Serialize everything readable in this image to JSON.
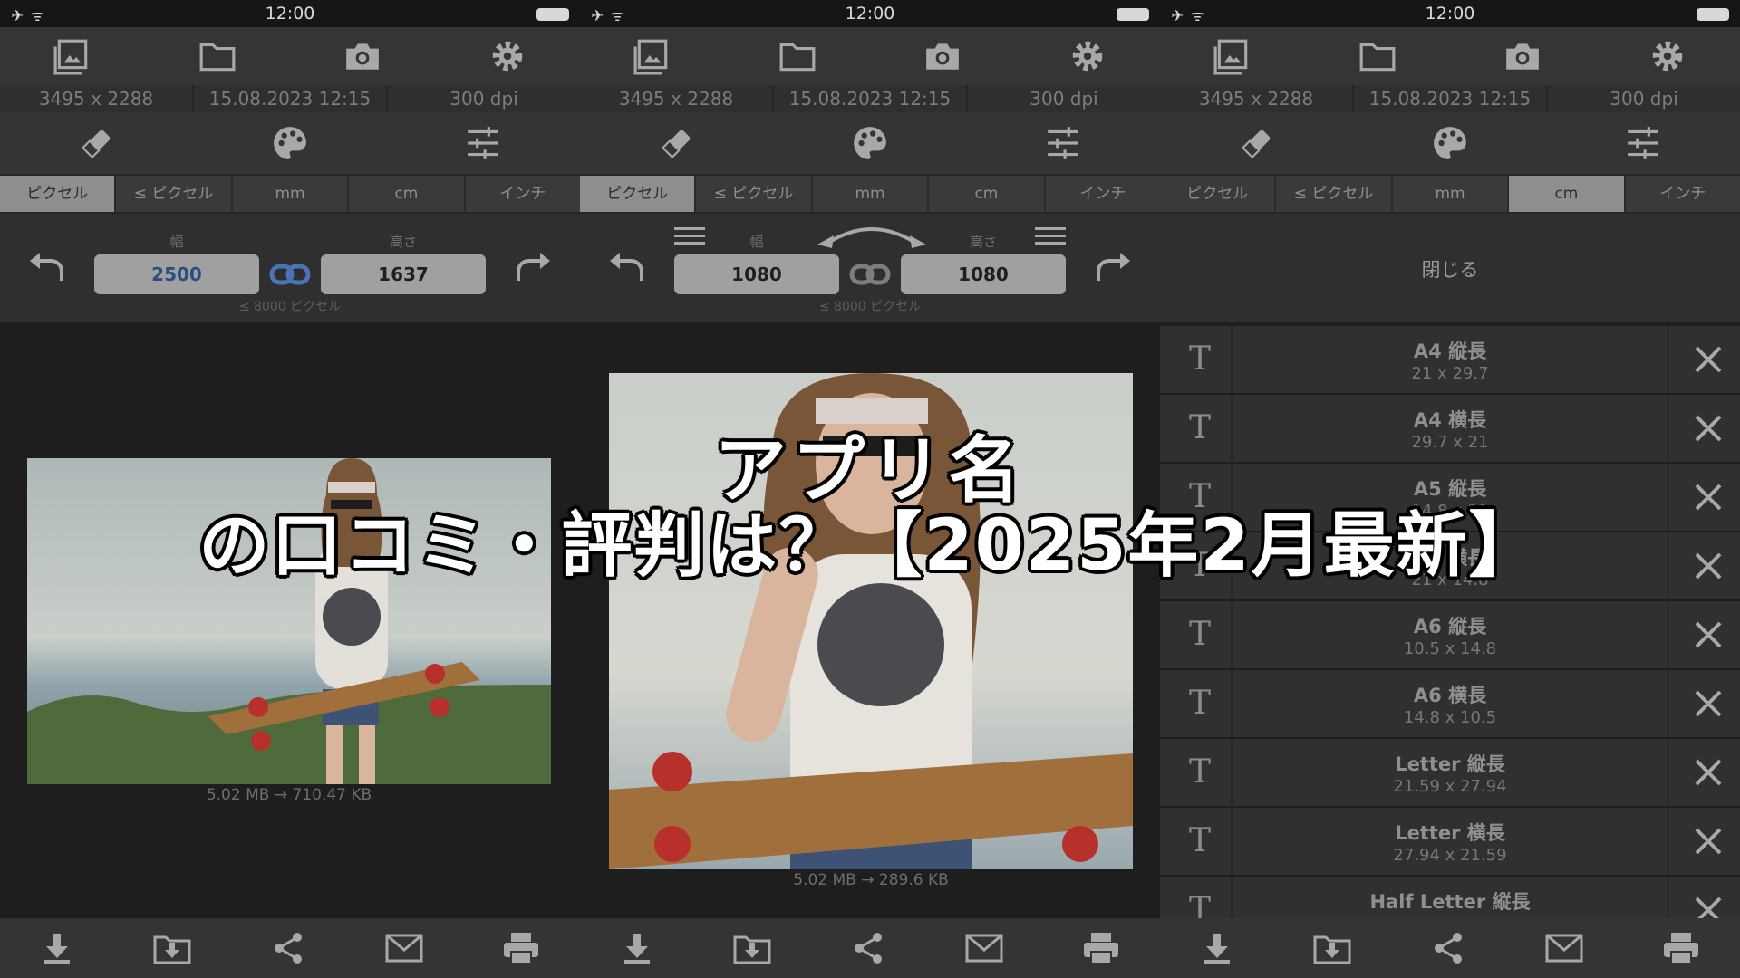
{
  "status": {
    "time": "12:00",
    "left_icons": "✈ ᯤ"
  },
  "toolbar_icons": [
    "gallery-icon",
    "folder-icon",
    "camera-icon",
    "settings-gear-icon"
  ],
  "info": {
    "dims": "3495 x 2288",
    "date": "15.08.2023 12:15",
    "dpi": "300 dpi"
  },
  "tools_icons": [
    "eraser-icon",
    "palette-icon",
    "sliders-icon"
  ],
  "units": [
    "ピクセル",
    "≤ ピクセル",
    "mm",
    "cm",
    "インチ"
  ],
  "panels": [
    {
      "selected_unit": 0,
      "width_label": "幅",
      "height_label": "高さ",
      "width": "2500",
      "height": "1637",
      "hint": "≤ 8000 ピクセル",
      "file_size": "5.02 MB  →  710.47 KB"
    },
    {
      "selected_unit": 0,
      "width_label": "幅",
      "height_label": "高さ",
      "width": "1080",
      "height": "1080",
      "hint": "≤ 8000 ピクセル",
      "file_size": "5.02 MB  →  289.6 KB"
    },
    {
      "selected_unit": 3,
      "close_label": "閉じる"
    }
  ],
  "presets": [
    {
      "name": "A4 縦長",
      "dims": "21 x 29.7"
    },
    {
      "name": "A4 横長",
      "dims": "29.7 x 21"
    },
    {
      "name": "A5 縦長",
      "dims": "14.8 x 21"
    },
    {
      "name": "A5 横長",
      "dims": "21 x 14.8"
    },
    {
      "name": "A6 縦長",
      "dims": "10.5 x 14.8"
    },
    {
      "name": "A6 横長",
      "dims": "14.8 x 10.5"
    },
    {
      "name": "Letter 縦長",
      "dims": "21.59 x 27.94"
    },
    {
      "name": "Letter 横長",
      "dims": "27.94 x 21.59"
    },
    {
      "name": "Half Letter 縦長",
      "dims": ""
    }
  ],
  "preset_t_label": "T",
  "bottom_icons": [
    "download-icon",
    "save-to-folder-icon",
    "share-icon",
    "mail-icon",
    "print-icon"
  ],
  "overlay": {
    "line1": "アプリ名",
    "line2": "の口コミ・評判は？【2025年2月最新】"
  },
  "colors": {
    "selected_segment": "#8e8e8e",
    "active_field_text": "#2c4d82",
    "link_icon_active": "#4a73b5"
  }
}
